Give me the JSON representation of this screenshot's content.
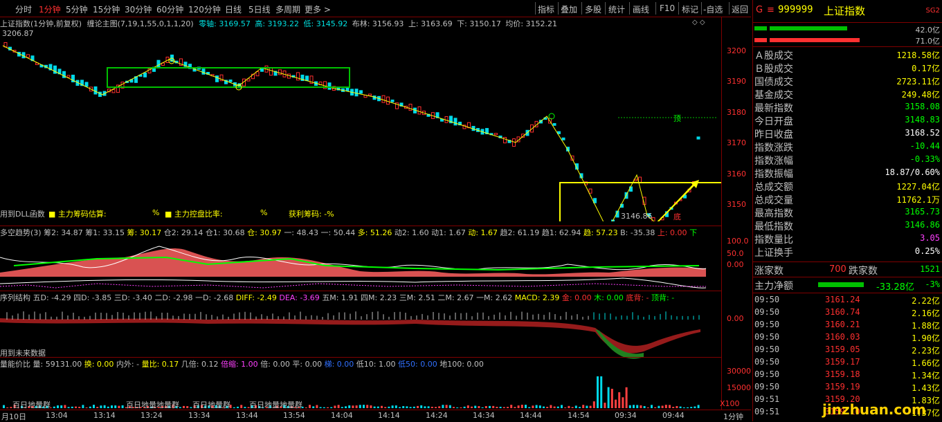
{
  "toolbar": {
    "timeframes": [
      "分时",
      "1分钟",
      "5分钟",
      "15分钟",
      "30分钟",
      "60分钟",
      "120分钟",
      "日线",
      "5日线",
      "多周期",
      "更多 >"
    ],
    "active_timeframe": "1分钟",
    "tools": [
      "指标",
      "叠加",
      "多股",
      "统计",
      "画线",
      "F10",
      "标记",
      "-自选",
      "返回"
    ]
  },
  "main": {
    "title": "上证指数(1分钟,前复权)",
    "indicator": "缠论主图(7,19,1,55,0,1,1,20)",
    "zero_axis": "零轴: 3169.57",
    "high": "高: 3193.22",
    "low": "低: 3145.92",
    "boll": "布林: 3156.93",
    "upper": "上: 3163.69",
    "lower": "下: 3150.17",
    "avg": "均价: 3152.21",
    "left_price": "3206.87",
    "min_label": "3146.86",
    "top_mark": "顶",
    "bottom_mark": "底",
    "dll_note": "用到DLL函数",
    "cost_label": "主力筹码估算:",
    "cost_unit": "%",
    "control_label": "主力控盘比率:",
    "control_unit": "%",
    "profit_label": "获利筹码: -%",
    "y_ticks": [
      "3200",
      "3190",
      "3180",
      "3170",
      "3160",
      "3150"
    ]
  },
  "panel2": {
    "name": "多空趋势(3)",
    "items": [
      "筹2: 34.87",
      "筹1: 33.15",
      "筹: 30.17",
      "仓2: 29.14",
      "仓1: 30.68",
      "仓: 30.97",
      "一: 48.43",
      "一: 50.44",
      "多: 51.26",
      "动2: 1.60",
      "动1: 1.67",
      "动: 1.67",
      "趋2: 61.19",
      "趋1: 62.94",
      "趋: 57.23",
      "B: -35.38",
      "上: 0.00",
      "下"
    ],
    "y_ticks": [
      "100.0",
      "50.0",
      "0.00"
    ]
  },
  "panel3": {
    "name": "序列结构",
    "items": [
      "五D: -4.29",
      "四D: -3.85",
      "三D: -3.40",
      "二D: -2.98",
      "一D: -2.68",
      "DIFF: -2.49",
      "DEA: -3.69",
      "五M: 1.91",
      "四M: 2.23",
      "三M: 2.51",
      "二M: 2.67",
      "一M: 2.62",
      "MACD: 2.39",
      "金: 0.00",
      "木: 0.00",
      "底背: -",
      "顶背: -"
    ],
    "future_note": "用到未来数据",
    "y_tick": "0.00"
  },
  "panel4": {
    "name": "量能价比",
    "items": [
      "量: 59131.00",
      "换: 0.00",
      "内外: -",
      "量比: 0.17",
      "几倍: 0.12",
      "倍缩: 1.00",
      "倍: 0.00",
      "平: 0.00",
      "梯: 0.00",
      "低10: 1.00",
      "低50: 0.00",
      "地100: 0.00"
    ],
    "notes": [
      "百日地量群",
      "百日地量地量群",
      "百日地量群",
      "百日地量地量群"
    ],
    "y_ticks": [
      "30000",
      "15000"
    ],
    "scale": "X100"
  },
  "xaxis": {
    "ticks": [
      "月10日",
      "13:04",
      "13:14",
      "13:24",
      "13:34",
      "13:44",
      "13:54",
      "14:04",
      "14:14",
      "14:24",
      "14:34",
      "14:44",
      "14:54",
      "09:34",
      "09:44"
    ],
    "period": "1分钟"
  },
  "quote": {
    "tag": "G",
    "code": "999999",
    "name": "上证指数",
    "badge": "SG2",
    "bar1": "42.0亿",
    "bar2": "71.0亿",
    "rows": [
      {
        "label": "Ａ股成交",
        "value": "1218.58亿",
        "color": "#ffff00"
      },
      {
        "label": "Ｂ股成交",
        "value": "0.17亿",
        "color": "#ffff00"
      },
      {
        "label": "国债成交",
        "value": "2723.11亿",
        "color": "#ffff00"
      },
      {
        "label": "基金成交",
        "value": "249.48亿",
        "color": "#ffff00"
      },
      {
        "label": "最新指数",
        "value": "3158.08",
        "color": "#00ff00"
      },
      {
        "label": "今日开盘",
        "value": "3148.83",
        "color": "#00ff00"
      },
      {
        "label": "昨日收盘",
        "value": "3168.52",
        "color": "#ffffff"
      },
      {
        "label": "指数涨跌",
        "value": "-10.44",
        "color": "#00ff00"
      },
      {
        "label": "指数涨幅",
        "value": "-0.33%",
        "color": "#00ff00"
      },
      {
        "label": "指数振幅",
        "value": "18.87/0.60%",
        "color": "#ffffff"
      },
      {
        "label": "总成交额",
        "value": "1227.04亿",
        "color": "#ffff00"
      },
      {
        "label": "总成交量",
        "value": "11762.1万",
        "color": "#ffff00"
      },
      {
        "label": "最高指数",
        "value": "3165.73",
        "color": "#00ff00"
      },
      {
        "label": "最低指数",
        "value": "3146.86",
        "color": "#00ff00"
      },
      {
        "label": "指数量比",
        "value": "3.05",
        "color": "#ff40ff"
      },
      {
        "label": "上证换手",
        "value": "0.25%",
        "color": "#ffffff"
      }
    ],
    "up_label": "涨家数",
    "up_value": "700",
    "down_label": "跌家数",
    "down_value": "1521",
    "net_label": "主力净额",
    "net_value": "-33.28亿",
    "net_pct": "-3%",
    "ticks": [
      {
        "time": "09:50",
        "price": "3161.24",
        "vol": "2.22亿"
      },
      {
        "time": "09:50",
        "price": "3160.74",
        "vol": "2.16亿"
      },
      {
        "time": "09:50",
        "price": "3160.21",
        "vol": "1.88亿"
      },
      {
        "time": "09:50",
        "price": "3160.03",
        "vol": "1.90亿"
      },
      {
        "time": "09:50",
        "price": "3159.05",
        "vol": "2.23亿"
      },
      {
        "time": "09:50",
        "price": "3159.17",
        "vol": "1.66亿"
      },
      {
        "time": "09:50",
        "price": "3159.18",
        "vol": "1.34亿"
      },
      {
        "time": "09:50",
        "price": "3159.19",
        "vol": "1.43亿"
      },
      {
        "time": "09:51",
        "price": "3159.20",
        "vol": "1.83亿"
      },
      {
        "time": "09:51",
        "price": "3159.10",
        "vol": "1.37亿"
      }
    ],
    "watermark": "jinzhuan.com"
  }
}
